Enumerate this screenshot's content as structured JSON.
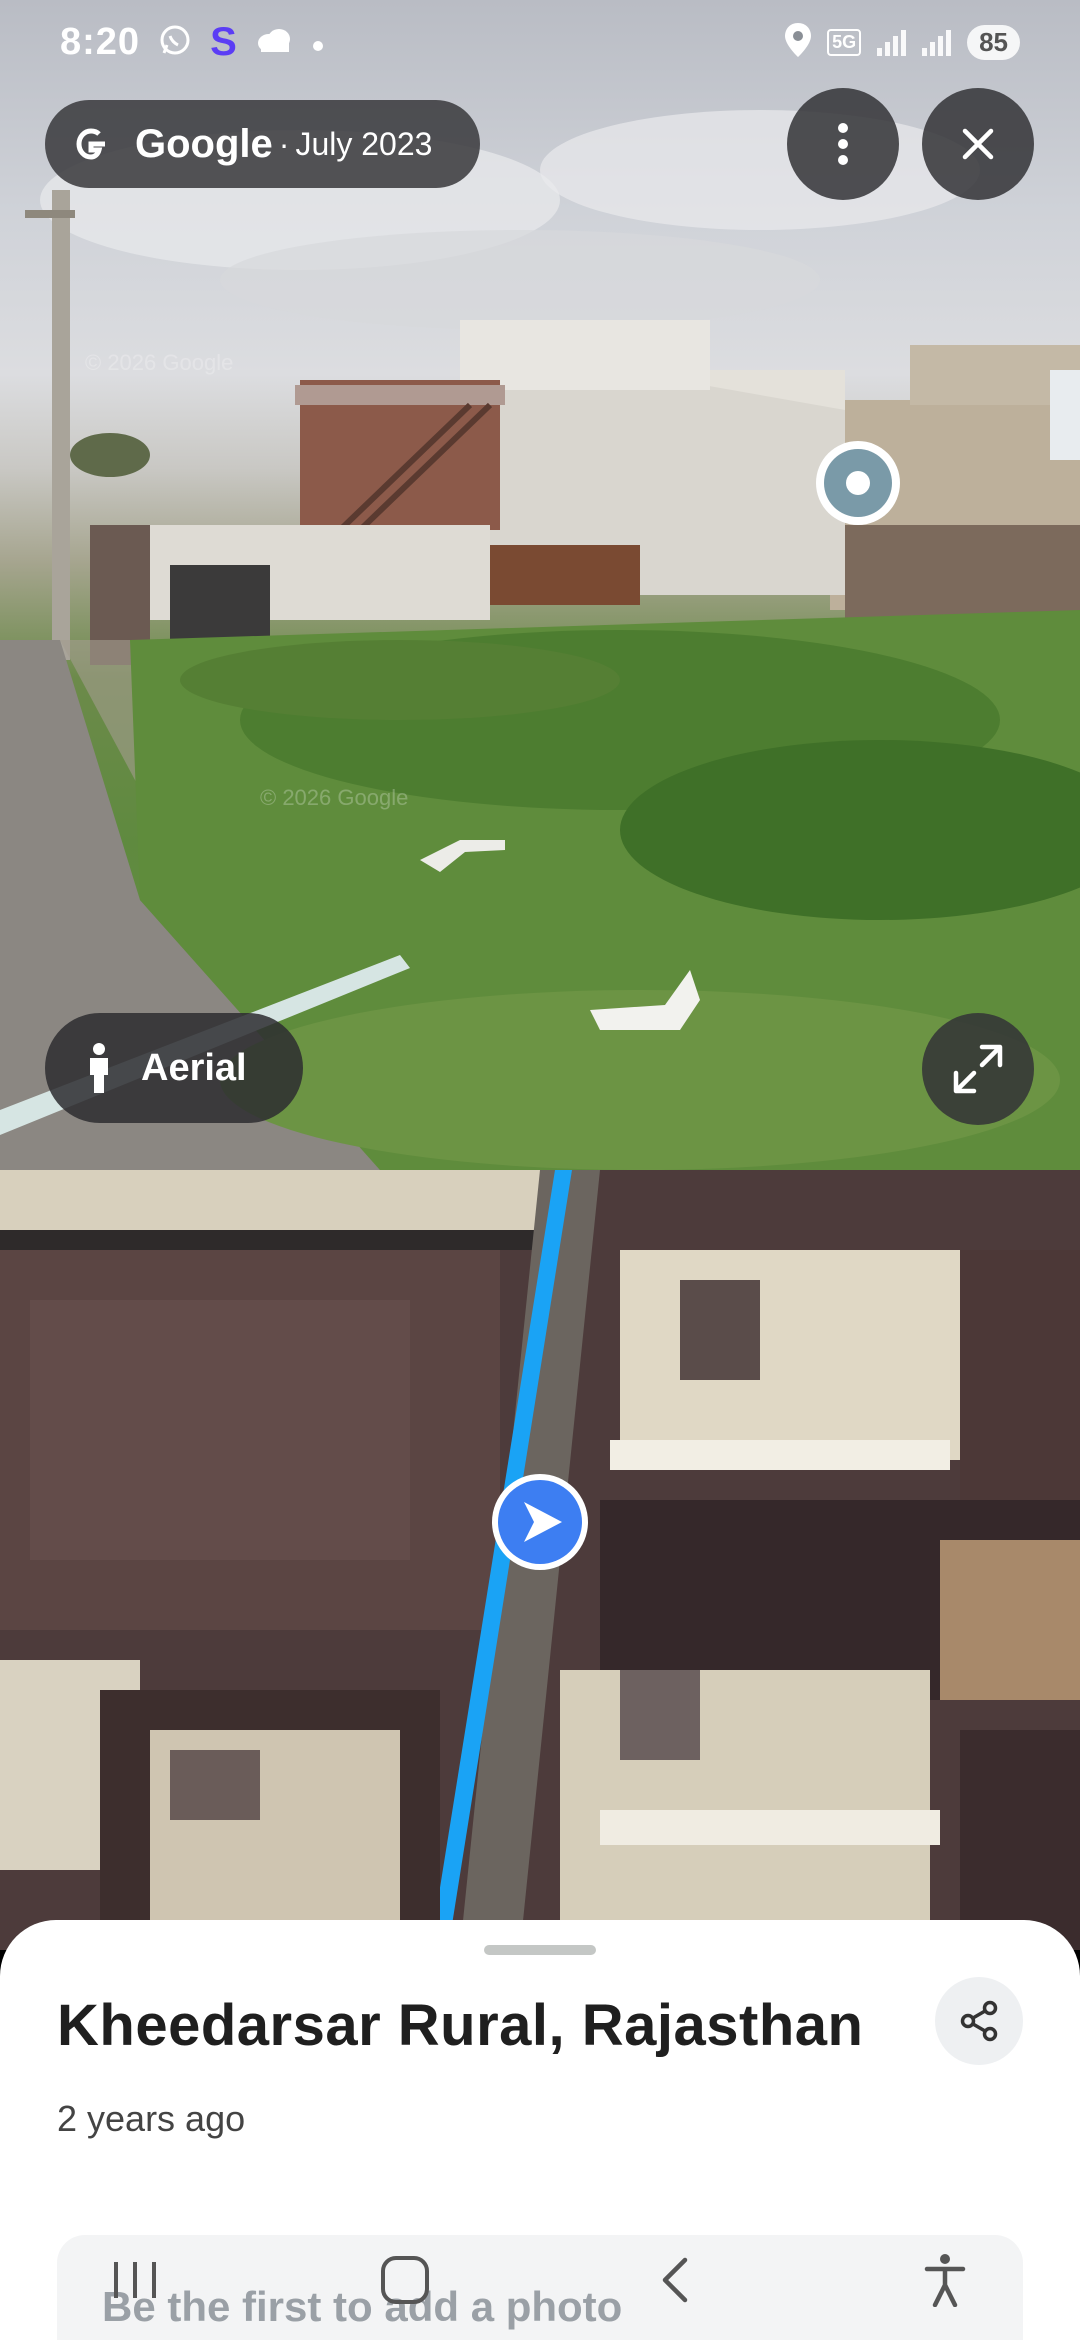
{
  "status_bar": {
    "time": "8:20",
    "network": "5G",
    "battery": "85"
  },
  "attribution": {
    "brand": "Google",
    "separator": "·",
    "date": "July 2023"
  },
  "street_view": {
    "aerial_button_label": "Aerial",
    "watermark": "© 2026 Google"
  },
  "place": {
    "title": "Kheedarsar Rural, Rajasthan",
    "subtitle": "2 years ago",
    "photo_prompt": "Be the first to add a photo"
  },
  "icons": {
    "more": "more-vert-icon",
    "close": "close-icon",
    "expand": "expand-icon",
    "share": "share-icon",
    "person": "pegman-icon",
    "heading": "navigation-arrow-icon"
  },
  "colors": {
    "route_blue": "#1aa3f5",
    "location_blue": "#3d7ef2",
    "pill_bg": "#3c3c40"
  }
}
